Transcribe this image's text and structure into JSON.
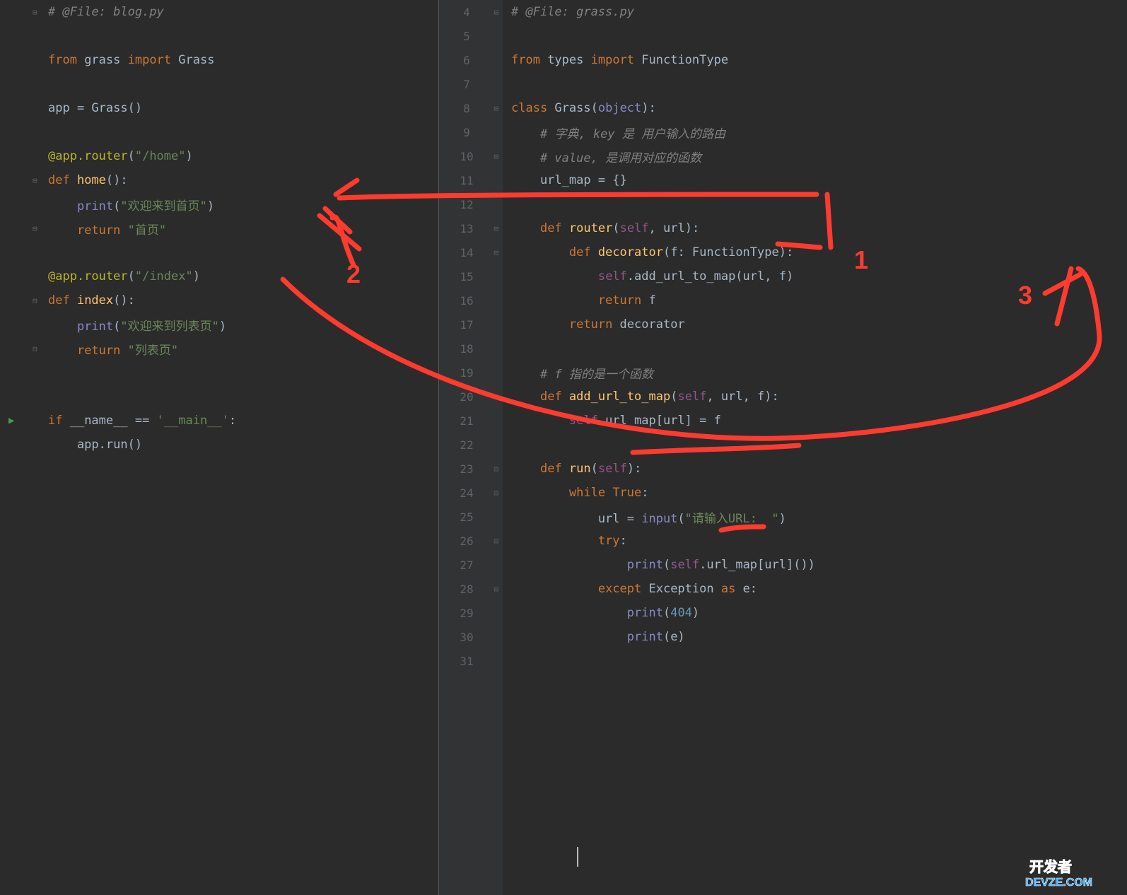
{
  "left": {
    "lines": [
      {
        "ln": "",
        "fold": "⊟",
        "tokens": [
          {
            "t": "# @File: blog.py",
            "cls": "c-comment"
          }
        ]
      },
      {
        "ln": "",
        "tokens": []
      },
      {
        "ln": "",
        "tokens": [
          {
            "t": "from ",
            "cls": "c-keyword"
          },
          {
            "t": "grass ",
            "cls": "c-default"
          },
          {
            "t": "import ",
            "cls": "c-keyword"
          },
          {
            "t": "Grass",
            "cls": "c-default"
          }
        ]
      },
      {
        "ln": "",
        "tokens": []
      },
      {
        "ln": "",
        "tokens": [
          {
            "t": "app = Grass()",
            "cls": "c-default"
          }
        ]
      },
      {
        "ln": "",
        "tokens": []
      },
      {
        "ln": "",
        "tokens": [
          {
            "t": "@app.router",
            "cls": "c-decorator"
          },
          {
            "t": "(",
            "cls": "c-paren"
          },
          {
            "t": "\"/home\"",
            "cls": "c-string"
          },
          {
            "t": ")",
            "cls": "c-paren"
          }
        ]
      },
      {
        "ln": "",
        "fold": "⊟",
        "tokens": [
          {
            "t": "def ",
            "cls": "c-keyword"
          },
          {
            "t": "home",
            "cls": "c-def"
          },
          {
            "t": "():",
            "cls": "c-paren"
          }
        ]
      },
      {
        "ln": "",
        "tokens": [
          {
            "t": "    ",
            "cls": "c-default"
          },
          {
            "t": "print",
            "cls": "c-builtin"
          },
          {
            "t": "(",
            "cls": "c-paren"
          },
          {
            "t": "\"欢迎来到首页\"",
            "cls": "c-string"
          },
          {
            "t": ")",
            "cls": "c-paren"
          }
        ]
      },
      {
        "ln": "",
        "fold": "⊟",
        "tokens": [
          {
            "t": "    ",
            "cls": "c-default"
          },
          {
            "t": "return ",
            "cls": "c-keyword"
          },
          {
            "t": "\"首页\"",
            "cls": "c-string"
          }
        ]
      },
      {
        "ln": "",
        "tokens": []
      },
      {
        "ln": "",
        "tokens": [
          {
            "t": "@app.router",
            "cls": "c-decorator"
          },
          {
            "t": "(",
            "cls": "c-paren"
          },
          {
            "t": "\"/index\"",
            "cls": "c-string"
          },
          {
            "t": ")",
            "cls": "c-paren"
          }
        ]
      },
      {
        "ln": "",
        "fold": "⊟",
        "tokens": [
          {
            "t": "def ",
            "cls": "c-keyword"
          },
          {
            "t": "index",
            "cls": "c-def"
          },
          {
            "t": "():",
            "cls": "c-paren"
          }
        ]
      },
      {
        "ln": "",
        "tokens": [
          {
            "t": "    ",
            "cls": "c-default"
          },
          {
            "t": "print",
            "cls": "c-builtin"
          },
          {
            "t": "(",
            "cls": "c-paren"
          },
          {
            "t": "\"欢迎来到列表页\"",
            "cls": "c-string"
          },
          {
            "t": ")",
            "cls": "c-paren"
          }
        ]
      },
      {
        "ln": "",
        "fold": "⊟",
        "tokens": [
          {
            "t": "    ",
            "cls": "c-default"
          },
          {
            "t": "return ",
            "cls": "c-keyword"
          },
          {
            "t": "\"列表页\"",
            "cls": "c-string"
          }
        ]
      },
      {
        "ln": "",
        "tokens": []
      },
      {
        "ln": "",
        "tokens": []
      },
      {
        "ln": "",
        "run": true,
        "tokens": [
          {
            "t": "if ",
            "cls": "c-keyword"
          },
          {
            "t": "__name__ == ",
            "cls": "c-default"
          },
          {
            "t": "'__main__'",
            "cls": "c-string"
          },
          {
            "t": ":",
            "cls": "c-paren"
          }
        ]
      },
      {
        "ln": "",
        "tokens": [
          {
            "t": "    app.run()",
            "cls": "c-default"
          }
        ]
      }
    ]
  },
  "right": {
    "lines": [
      {
        "ln": "4",
        "fold": "⊟",
        "tokens": [
          {
            "t": "# @File: grass.py",
            "cls": "c-comment"
          }
        ]
      },
      {
        "ln": "5",
        "tokens": []
      },
      {
        "ln": "6",
        "tokens": [
          {
            "t": "from ",
            "cls": "c-keyword"
          },
          {
            "t": "types ",
            "cls": "c-default"
          },
          {
            "t": "import ",
            "cls": "c-keyword"
          },
          {
            "t": "FunctionType",
            "cls": "c-default"
          }
        ]
      },
      {
        "ln": "7",
        "tokens": []
      },
      {
        "ln": "8",
        "fold": "⊟",
        "tokens": [
          {
            "t": "class ",
            "cls": "c-keyword"
          },
          {
            "t": "Grass",
            "cls": "c-default"
          },
          {
            "t": "(",
            "cls": "c-paren"
          },
          {
            "t": "object",
            "cls": "c-builtin"
          },
          {
            "t": "):",
            "cls": "c-paren"
          }
        ]
      },
      {
        "ln": "9",
        "tokens": [
          {
            "t": "    ",
            "cls": "c-default"
          },
          {
            "t": "# 字典, key 是 用户输入的路由",
            "cls": "c-comment"
          }
        ]
      },
      {
        "ln": "10",
        "fold": "⊟",
        "tokens": [
          {
            "t": "    ",
            "cls": "c-default"
          },
          {
            "t": "# value, 是调用对应的函数",
            "cls": "c-comment"
          }
        ]
      },
      {
        "ln": "11",
        "tokens": [
          {
            "t": "    url_map = {}",
            "cls": "c-default"
          }
        ]
      },
      {
        "ln": "12",
        "tokens": []
      },
      {
        "ln": "13",
        "fold": "⊟",
        "tokens": [
          {
            "t": "    ",
            "cls": "c-default"
          },
          {
            "t": "def ",
            "cls": "c-keyword"
          },
          {
            "t": "router",
            "cls": "c-def"
          },
          {
            "t": "(",
            "cls": "c-paren"
          },
          {
            "t": "self",
            "cls": "c-self"
          },
          {
            "t": ", url):",
            "cls": "c-default"
          }
        ]
      },
      {
        "ln": "14",
        "fold": "⊟",
        "tokens": [
          {
            "t": "        ",
            "cls": "c-default"
          },
          {
            "t": "def ",
            "cls": "c-keyword"
          },
          {
            "t": "decorator",
            "cls": "c-def"
          },
          {
            "t": "(f: FunctionType):",
            "cls": "c-default"
          }
        ]
      },
      {
        "ln": "15",
        "tokens": [
          {
            "t": "            ",
            "cls": "c-default"
          },
          {
            "t": "self",
            "cls": "c-self"
          },
          {
            "t": ".add_url_to_map(url, f)",
            "cls": "c-default"
          }
        ]
      },
      {
        "ln": "16",
        "tokens": [
          {
            "t": "            ",
            "cls": "c-default"
          },
          {
            "t": "return ",
            "cls": "c-keyword"
          },
          {
            "t": "f",
            "cls": "c-default"
          }
        ]
      },
      {
        "ln": "17",
        "tokens": [
          {
            "t": "        ",
            "cls": "c-default"
          },
          {
            "t": "return ",
            "cls": "c-keyword"
          },
          {
            "t": "decorator",
            "cls": "c-default"
          }
        ]
      },
      {
        "ln": "18",
        "tokens": []
      },
      {
        "ln": "19",
        "tokens": [
          {
            "t": "    ",
            "cls": "c-default"
          },
          {
            "t": "# f 指的是一个函数",
            "cls": "c-comment"
          }
        ]
      },
      {
        "ln": "20",
        "fold": "⊟",
        "tokens": [
          {
            "t": "    ",
            "cls": "c-default"
          },
          {
            "t": "def ",
            "cls": "c-keyword"
          },
          {
            "t": "add_url_to_map",
            "cls": "c-def"
          },
          {
            "t": "(",
            "cls": "c-paren"
          },
          {
            "t": "self",
            "cls": "c-self"
          },
          {
            "t": ", url, f):",
            "cls": "c-default"
          }
        ]
      },
      {
        "ln": "21",
        "tokens": [
          {
            "t": "        ",
            "cls": "c-default"
          },
          {
            "t": "self",
            "cls": "c-self"
          },
          {
            "t": ".url_map[url] = f",
            "cls": "c-default"
          }
        ]
      },
      {
        "ln": "22",
        "tokens": []
      },
      {
        "ln": "23",
        "fold": "⊟",
        "tokens": [
          {
            "t": "    ",
            "cls": "c-default"
          },
          {
            "t": "def ",
            "cls": "c-keyword"
          },
          {
            "t": "run",
            "cls": "c-def"
          },
          {
            "t": "(",
            "cls": "c-paren"
          },
          {
            "t": "self",
            "cls": "c-self"
          },
          {
            "t": "):",
            "cls": "c-paren"
          }
        ]
      },
      {
        "ln": "24",
        "fold": "⊟",
        "tokens": [
          {
            "t": "        ",
            "cls": "c-default"
          },
          {
            "t": "while ",
            "cls": "c-keyword"
          },
          {
            "t": "True",
            "cls": "c-keyword"
          },
          {
            "t": ":",
            "cls": "c-paren"
          }
        ]
      },
      {
        "ln": "25",
        "tokens": [
          {
            "t": "            url = ",
            "cls": "c-default"
          },
          {
            "t": "input",
            "cls": "c-builtin"
          },
          {
            "t": "(",
            "cls": "c-paren"
          },
          {
            "t": "\"请输入URL:  \"",
            "cls": "c-string"
          },
          {
            "t": ")",
            "cls": "c-paren"
          }
        ]
      },
      {
        "ln": "26",
        "fold": "⊟",
        "tokens": [
          {
            "t": "            ",
            "cls": "c-default"
          },
          {
            "t": "try",
            "cls": "c-keyword"
          },
          {
            "t": ":",
            "cls": "c-paren"
          }
        ]
      },
      {
        "ln": "27",
        "tokens": [
          {
            "t": "                ",
            "cls": "c-default"
          },
          {
            "t": "print",
            "cls": "c-builtin"
          },
          {
            "t": "(",
            "cls": "c-paren"
          },
          {
            "t": "self",
            "cls": "c-self"
          },
          {
            "t": ".url_map[url]())",
            "cls": "c-default"
          }
        ]
      },
      {
        "ln": "28",
        "fold": "⊟",
        "tokens": [
          {
            "t": "            ",
            "cls": "c-default"
          },
          {
            "t": "except ",
            "cls": "c-keyword"
          },
          {
            "t": "Exception ",
            "cls": "c-default"
          },
          {
            "t": "as ",
            "cls": "c-keyword"
          },
          {
            "t": "e:",
            "cls": "c-default"
          }
        ]
      },
      {
        "ln": "29",
        "tokens": [
          {
            "t": "                ",
            "cls": "c-default"
          },
          {
            "t": "print",
            "cls": "c-builtin"
          },
          {
            "t": "(",
            "cls": "c-paren"
          },
          {
            "t": "404",
            "cls": "c-num"
          },
          {
            "t": ")",
            "cls": "c-paren"
          }
        ]
      },
      {
        "ln": "30",
        "tokens": [
          {
            "t": "                ",
            "cls": "c-default"
          },
          {
            "t": "print",
            "cls": "c-builtin"
          },
          {
            "t": "(e)",
            "cls": "c-default"
          }
        ]
      },
      {
        "ln": "31",
        "tokens": []
      }
    ]
  },
  "annotations": {
    "label1": "1",
    "label2": "2",
    "label3": "3"
  },
  "watermark": {
    "top": "开发者",
    "bottom": "DEVZE.COM"
  }
}
